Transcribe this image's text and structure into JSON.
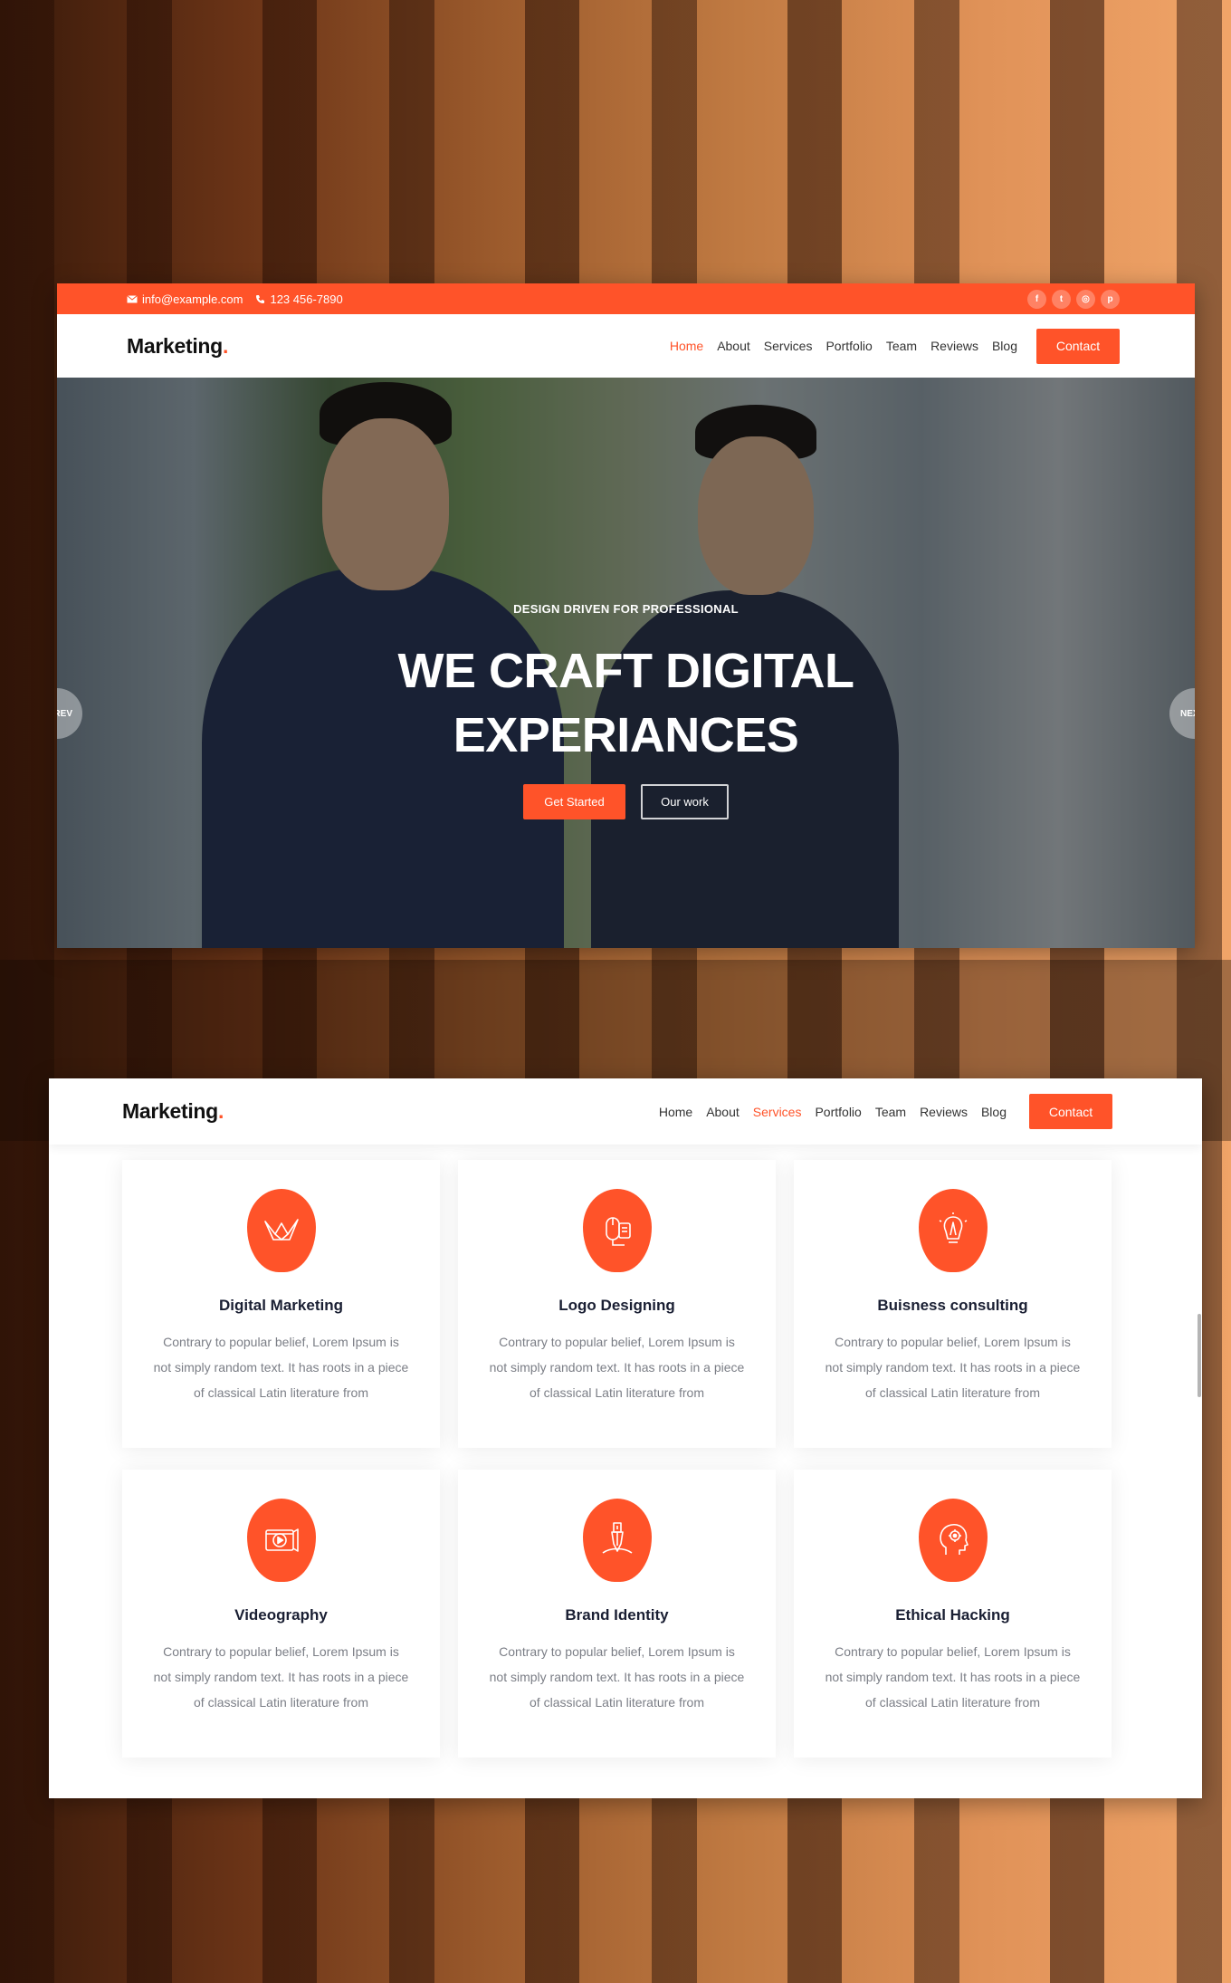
{
  "screen1": {
    "topbar": {
      "email": "info@example.com",
      "phone": "123 456-7890",
      "socials": [
        {
          "icon": "facebook-icon",
          "glyph": "f"
        },
        {
          "icon": "twitter-icon",
          "glyph": "t"
        },
        {
          "icon": "instagram-icon",
          "glyph": "◎"
        },
        {
          "icon": "pinterest-icon",
          "glyph": "p"
        }
      ]
    },
    "logo": {
      "text": "Marketing",
      "dot": "."
    },
    "nav": {
      "items": [
        "Home",
        "About",
        "Services",
        "Portfolio",
        "Team",
        "Reviews",
        "Blog"
      ],
      "active": "Home",
      "contact": "Contact"
    },
    "hero": {
      "subtitle": "DESIGN DRIVEN FOR PROFESSIONAL",
      "title_line1": "WE CRAFT DIGITAL",
      "title_line2": "EXPERIANCES",
      "primary_button": "Get Started",
      "secondary_button": "Our work",
      "prev": "PREV",
      "next": "NEXT"
    }
  },
  "screen2": {
    "logo": {
      "text": "Marketing",
      "dot": "."
    },
    "nav": {
      "items": [
        "Home",
        "About",
        "Services",
        "Portfolio",
        "Team",
        "Reviews",
        "Blog"
      ],
      "active": "Services",
      "contact": "Contact"
    },
    "services": [
      {
        "title": "Digital Marketing",
        "icon": "origami-crane-icon",
        "text": "Contrary to popular belief, Lorem Ipsum is not simply random text. It has roots in a piece of classical Latin literature from"
      },
      {
        "title": "Logo Designing",
        "icon": "mouse-design-icon",
        "text": "Contrary to popular belief, Lorem Ipsum is not simply random text. It has roots in a piece of classical Latin literature from"
      },
      {
        "title": "Buisness consulting",
        "icon": "idea-pen-icon",
        "text": "Contrary to popular belief, Lorem Ipsum is not simply random text. It has roots in a piece of classical Latin literature from"
      },
      {
        "title": "Videography",
        "icon": "video-play-icon",
        "text": "Contrary to popular belief, Lorem Ipsum is not simply random text. It has roots in a piece of classical Latin literature from"
      },
      {
        "title": "Brand Identity",
        "icon": "pen-tool-icon",
        "text": "Contrary to popular belief, Lorem Ipsum is not simply random text. It has roots in a piece of classical Latin literature from"
      },
      {
        "title": "Ethical Hacking",
        "icon": "head-gear-icon",
        "text": "Contrary to popular belief, Lorem Ipsum is not simply random text. It has roots in a piece of classical Latin literature from"
      }
    ]
  },
  "colors": {
    "accent": "#ff5329",
    "heading": "#1a1f33",
    "body_text": "#7b7e86"
  }
}
